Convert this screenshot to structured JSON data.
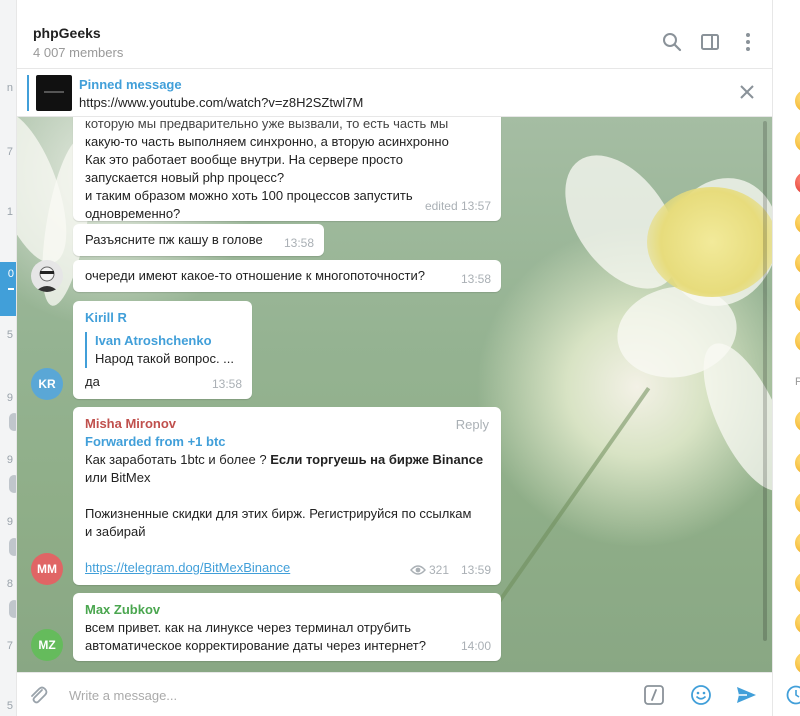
{
  "header": {
    "title": "phpGeeks",
    "members": "4 007 members"
  },
  "pinned": {
    "title": "Pinned message",
    "text": "https://www.youtube.com/watch?v=z8H2SZtwl7M"
  },
  "messages": {
    "m1": {
      "partial_line": "которую мы предварительно уже вызвали, то есть часть мы",
      "lines": [
        "какую-то часть выполняем синхронно, а вторую асинхронно",
        "Как это работает вообще внутри. На сервере просто",
        "запускается новый php процесс?",
        "и таким образом можно хоть 100 процессов запустить",
        "одновременно?"
      ],
      "time": "edited 13:57"
    },
    "m2": {
      "text": "Разъясните пж кашу в голове",
      "time": "13:58"
    },
    "m3": {
      "text": "очереди имеют какое-то отношение к многопоточности?",
      "time": "13:58"
    },
    "m4": {
      "sender": "Kirill R",
      "reply_name": "Ivan Atroshchenko",
      "reply_text": "Народ такой вопрос. ...",
      "text": "да",
      "time": "13:58",
      "avatar": "KR"
    },
    "m5": {
      "sender": "Misha Mironov",
      "reply_label": "Reply",
      "forwarded": "Forwarded from +1 btc",
      "line1_plain": "Как заработать 1btc и более ? ",
      "line1_bold": "Если торгуешь на бирже Binance",
      "line2": "или BitMex",
      "line3": "Пожизненные скидки для этих бирж. Регистрируйся по ссылкам",
      "line4": "и забирай",
      "link": "https://telegram.dog/BitMexBinance",
      "views": "321",
      "time": "13:59",
      "avatar": "MM"
    },
    "m6": {
      "sender": "Max Zubkov",
      "lines": [
        "всем привет. как на линуксе через терминал отрубить",
        "автоматическое корректирование даты через интернет?"
      ],
      "time": "14:00",
      "avatar": "MZ"
    }
  },
  "composer": {
    "placeholder": "Write a message..."
  },
  "left_strip": {
    "fragments": [
      "n",
      "7",
      "1",
      "0",
      "5",
      "9",
      "9",
      "9",
      "8",
      "7",
      "5"
    ]
  },
  "right_panel": {
    "section_letter": "P"
  },
  "colors": {
    "accent": "#419fd9",
    "kr": "#5aa7d6",
    "mm": "#e06565",
    "mz": "#65bb5c",
    "misha": "#c0504d",
    "max": "#4aa64f"
  }
}
